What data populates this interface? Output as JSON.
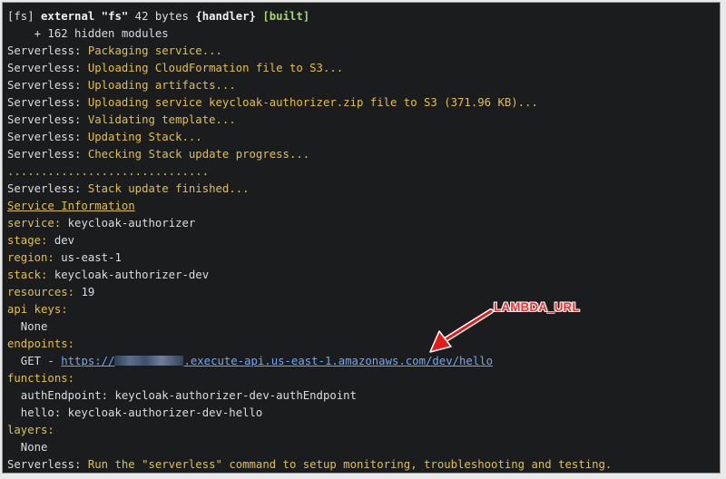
{
  "colors": {
    "background": "#1b1c1d",
    "text": "#dcdcdc",
    "message": "#e2c044",
    "key": "#e2c044",
    "link": "#6aa8ff",
    "annotation": "#ff2a2a"
  },
  "build": {
    "prefix": "[fs] ",
    "name": "external \"fs\"",
    "size": " 42 bytes ",
    "chunk": "{handler}",
    "status": "[built]",
    "hidden_modules": "    + 162 hidden modules"
  },
  "log": {
    "label": "Serverless: ",
    "messages": [
      "Packaging service...",
      "Uploading CloudFormation file to S3...",
      "Uploading artifacts...",
      "Uploading service keycloak-authorizer.zip file to S3 (371.96 KB)...",
      "Validating template...",
      "Updating Stack...",
      "Checking Stack update progress..."
    ],
    "progress_dots": "..............................",
    "finished": "Stack update finished..."
  },
  "service_info": {
    "heading": "Service Information",
    "service_key": "service:",
    "service_value": " keycloak-authorizer",
    "stage_key": "stage:",
    "stage_value": " dev",
    "region_key": "region:",
    "region_value": " us-east-1",
    "stack_key": "stack:",
    "stack_value": " keycloak-authorizer-dev",
    "resources_key": "resources:",
    "resources_value": " 19",
    "api_keys_key": "api keys:",
    "api_keys_value": "  None",
    "endpoints_key": "endpoints:",
    "endpoint_method": "  GET - ",
    "endpoint_url_start": "https://",
    "endpoint_url_end": ".execute-api.us-east-1.amazonaws.com/dev/hello",
    "functions_key": "functions:",
    "functions": [
      "  authEndpoint: keycloak-authorizer-dev-authEndpoint",
      "  hello: keycloak-authorizer-dev-hello"
    ],
    "layers_key": "layers:",
    "layers_value": "  None"
  },
  "footer": {
    "label": "Serverless: ",
    "message": "Run the \"serverless\" command to setup monitoring, troubleshooting and testing."
  },
  "annotation": {
    "text": "LAMBDA_URL"
  }
}
